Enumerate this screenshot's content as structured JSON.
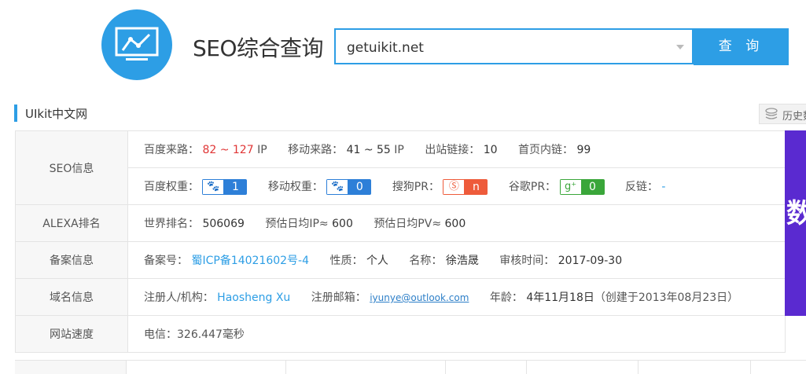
{
  "header": {
    "title": "SEO综合查询",
    "search_value": "getuikit.net",
    "search_button": "查 询"
  },
  "section": {
    "title": "UIkit中文网",
    "history_label": "历史数"
  },
  "rows": {
    "seo": {
      "label": "SEO信息",
      "baidu_traffic_k": "百度来路：",
      "baidu_traffic_v": "82 ~ 127",
      "baidu_traffic_unit": "IP",
      "mobile_traffic_k": "移动来路：",
      "mobile_traffic_v": "41 ~ 55",
      "mobile_traffic_unit": "IP",
      "outlinks_k": "出站链接：",
      "outlinks_v": "10",
      "homelinks_k": "首页内链：",
      "homelinks_v": "99",
      "baidu_weight_k": "百度权重：",
      "baidu_weight_v": "1",
      "mobile_weight_k": "移动权重：",
      "mobile_weight_v": "0",
      "sogou_pr_k": "搜狗PR：",
      "sogou_pr_v": "n",
      "google_pr_k": "谷歌PR：",
      "google_pr_v": "0",
      "backlinks_k": "反链：",
      "backlinks_v": "-"
    },
    "alexa": {
      "label": "ALEXA排名",
      "rank_k": "世界排名：",
      "rank_v": "506069",
      "ip_k": "预估日均IP≈",
      "ip_v": "600",
      "pv_k": "预估日均PV≈",
      "pv_v": "600"
    },
    "icp": {
      "label": "备案信息",
      "no_k": "备案号：",
      "no_v": "蜀ICP备14021602号-4",
      "nature_k": "性质：",
      "nature_v": "个人",
      "name_k": "名称：",
      "name_v": "徐浩晟",
      "date_k": "审核时间：",
      "date_v": "2017-09-30"
    },
    "domain": {
      "label": "域名信息",
      "registrant_k": "注册人/机构：",
      "registrant_v": "Haosheng Xu",
      "email_k": "注册邮箱：",
      "email_v": "iyunye@outlook.com",
      "age_k": "年龄：",
      "age_v": "4年11月18日",
      "created": "（创建于2013年08月23日）"
    },
    "speed": {
      "label": "网站速度",
      "telecom": "电信：326.447毫秒"
    }
  },
  "banner_text": "数",
  "colors": {
    "accent": "#2d9ee5",
    "baidu_badge": "#2d7fd8",
    "sogou_badge": "#ee5b3b",
    "google_badge": "#3aa63a",
    "banner": "#5a2ad0"
  }
}
